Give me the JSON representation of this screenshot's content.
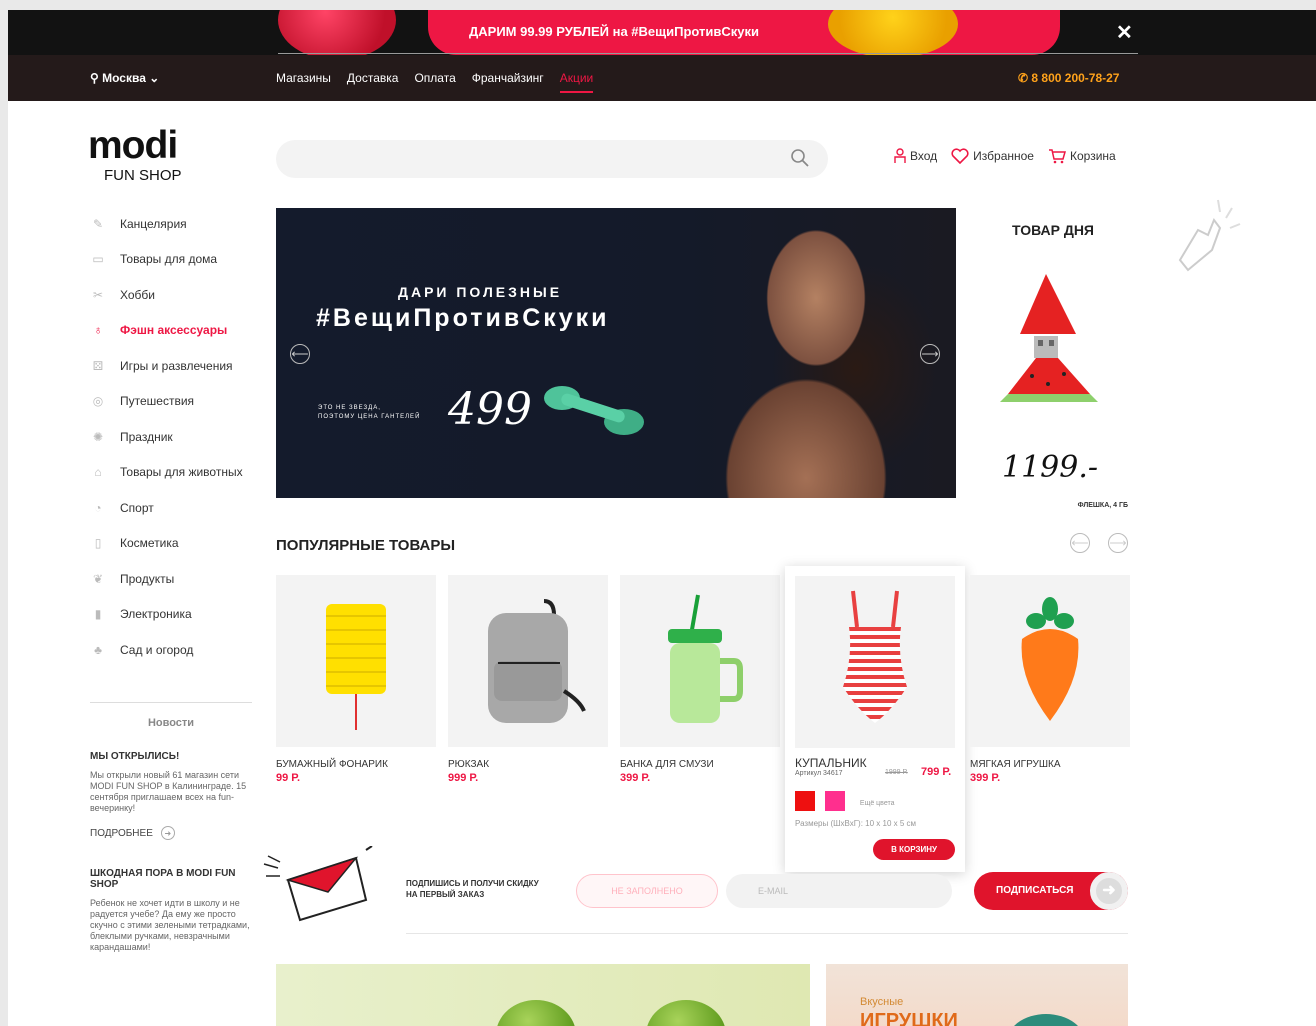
{
  "promo": {
    "text": "ДАРИМ 99.99 РУБЛЕЙ на #ВещиПротивСкуки",
    "close": "✕"
  },
  "nav": {
    "city": "Москва",
    "links": [
      "Магазины",
      "Доставка",
      "Оплата",
      "Франчайзинг",
      "Акции"
    ],
    "active_index": 4,
    "phone": "8 800 200-78-27"
  },
  "logo": {
    "brand": "modi",
    "sub": "FUN SHOP"
  },
  "search": {
    "placeholder": "",
    "icon": "search-icon"
  },
  "header_actions": {
    "login": "Вход",
    "favorites": "Избранное",
    "cart": "Корзина"
  },
  "categories": [
    {
      "label": "Канцелярия",
      "icon": "pencil-icon"
    },
    {
      "label": "Товары для дома",
      "icon": "jar-icon"
    },
    {
      "label": "Хобби",
      "icon": "scissors-icon"
    },
    {
      "label": "Фэшн аксессуары",
      "icon": "balloon-icon",
      "active": true
    },
    {
      "label": "Игры и развлечения",
      "icon": "gamepad-icon"
    },
    {
      "label": "Путешествия",
      "icon": "globe-icon"
    },
    {
      "label": "Праздник",
      "icon": "party-icon"
    },
    {
      "label": "Товары для животных",
      "icon": "pet-icon"
    },
    {
      "label": "Спорт",
      "icon": "ball-icon"
    },
    {
      "label": "Косметика",
      "icon": "cosmetics-icon"
    },
    {
      "label": "Продукты",
      "icon": "food-icon"
    },
    {
      "label": "Электроника",
      "icon": "bottle-icon"
    },
    {
      "label": "Сад и огород",
      "icon": "plant-icon"
    }
  ],
  "news": {
    "title": "Новости",
    "items": [
      {
        "heading": "МЫ ОТКРЫЛИСЬ!",
        "text": "Мы открыли новый 61 магазин сети MODI FUN SHOP в Калининграде. 15 сентября приглашаем всех на fun-вечеринку!",
        "more": "ПОДРОБНЕЕ"
      },
      {
        "heading": "ШКОДНАЯ ПОРА В MODI FUN SHOP",
        "text": "Ребенок не хочет идти в школу и не радуется учебе? Да ему же просто скучно с этими зелеными тетрадками, блеклыми ручками, невзрачными карандашами!"
      }
    ]
  },
  "banner": {
    "subtitle": "ДАРИ ПОЛЕЗНЫЕ",
    "tagline": "#ВещиПротивСкуки",
    "small_1": "ЭТО НЕ ЗВЕЗДА,",
    "small_2": "ПОЭТОМУ ЦЕНА ГАНТЕЛЕЙ",
    "price": "499"
  },
  "product_of_day": {
    "title": "ТОВАР ДНЯ",
    "price": "1199.-",
    "caption": "ФЛЕШКА, 4 ГБ"
  },
  "popular": {
    "title": "ПОПУЛЯРНЫЕ ТОВАРЫ",
    "items": [
      {
        "name": "БУМАЖНЫЙ ФОНАРИК",
        "price": "99 Р."
      },
      {
        "name": "РЮКЗАК",
        "price": "999 Р."
      },
      {
        "name": "БАНКА ДЛЯ СМУЗИ",
        "price": "399 Р."
      },
      {
        "name": "КУПАЛЬНИК",
        "article": "Артикул 34617",
        "old_price": "1999 Р.",
        "price": "799 Р.",
        "more_colors": "Ещё цвета",
        "size": "Размеры (ШхВхГ): 10 х 10 х 5 см",
        "buy": "В КОРЗИНУ",
        "colors": [
          "#ee1010",
          "#ff2f8e"
        ]
      },
      {
        "name": "МЯГКАЯ ИГРУШКА",
        "price": "399 Р."
      }
    ]
  },
  "subscribe": {
    "text_1": "ПОДПИШИСЬ И ПОЛУЧИ СКИДКУ",
    "text_2": "НА ПЕРВЫЙ ЗАКАЗ",
    "name_placeholder": "НЕ ЗАПОЛНЕНО",
    "email_placeholder": "E-MAIL",
    "button": "ПОДПИСАТЬСЯ"
  },
  "bottom_banners": {
    "right_small": "Вкусные",
    "right_big": "ИГРУШКИ"
  },
  "colors": {
    "accent": "#ee1744",
    "phone": "#ffa21a",
    "nav_bg": "#241a1a"
  }
}
